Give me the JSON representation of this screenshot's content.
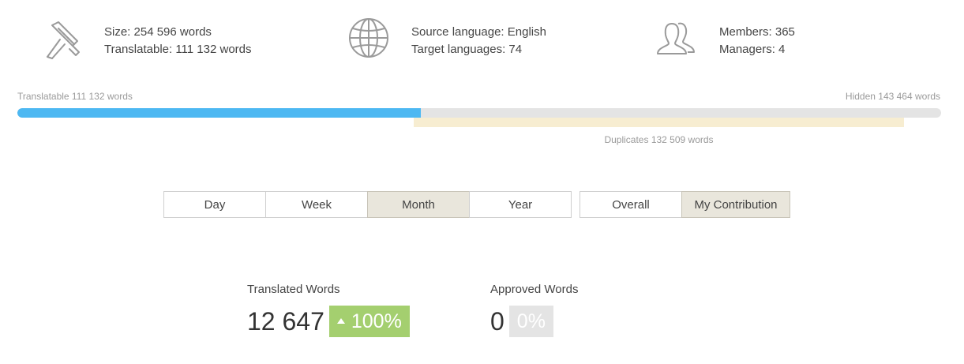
{
  "stats": {
    "size": {
      "icon": "caliper-icon",
      "line1": "Size: 254 596 words",
      "line2": "Translatable: 111 132 words"
    },
    "languages": {
      "icon": "globe-icon",
      "line1": "Source language: English",
      "line2": "Target languages: 74"
    },
    "members": {
      "icon": "users-icon",
      "line1": "Members: 365",
      "line2": "Managers: 4"
    }
  },
  "progress": {
    "left_label": "Translatable 111 132 words",
    "right_label": "Hidden 143 464 words",
    "duplicates_label": "Duplicates 132 509 words",
    "translatable_fraction": 0.4365,
    "fill_color": "#4db8f2",
    "track_color": "#e4e4e4",
    "duplicates_color": "#f7edd1"
  },
  "period_tabs": [
    {
      "label": "Day",
      "active": false
    },
    {
      "label": "Week",
      "active": false
    },
    {
      "label": "Month",
      "active": true
    },
    {
      "label": "Year",
      "active": false
    }
  ],
  "scope_tabs": [
    {
      "label": "Overall",
      "active": false
    },
    {
      "label": "My Contribution",
      "active": true
    }
  ],
  "metrics": {
    "translated": {
      "title": "Translated Words",
      "value": "12 647",
      "badge": "100%",
      "badge_color": "#a4cf6f",
      "trend": "up"
    },
    "approved": {
      "title": "Approved Words",
      "value": "0",
      "badge": "0%",
      "badge_color": "#e4e4e4"
    }
  }
}
